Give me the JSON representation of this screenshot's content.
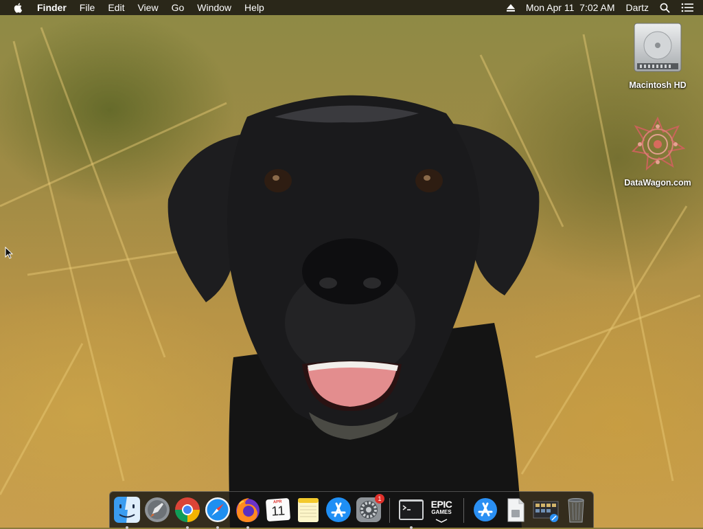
{
  "menubar": {
    "apple_icon": "apple-icon",
    "app_name": "Finder",
    "menus": [
      "File",
      "Edit",
      "View",
      "Go",
      "Window",
      "Help"
    ],
    "datetime": "Mon Apr 11  7:02 AM",
    "user": "Dartz",
    "status_icons": [
      "eject-icon",
      "spotlight-search-icon",
      "notification-center-icon"
    ]
  },
  "desktop": {
    "icons": [
      {
        "label": "Macintosh HD",
        "icon": "hard-drive-icon"
      },
      {
        "label": "DataWagon.com",
        "icon": "mandala-folder-icon"
      }
    ],
    "wallpaper": "black labrador dog in grass"
  },
  "dock": {
    "items": [
      {
        "name": "Finder",
        "icon": "finder-icon",
        "running": true
      },
      {
        "name": "Launchpad",
        "icon": "launchpad-icon",
        "running": false
      },
      {
        "name": "Google Chrome",
        "icon": "chrome-icon",
        "running": true
      },
      {
        "name": "Safari",
        "icon": "safari-icon",
        "running": true
      },
      {
        "name": "Firefox",
        "icon": "firefox-icon",
        "running": true
      },
      {
        "name": "Calendar",
        "icon": "calendar-icon",
        "running": false,
        "month": "APR",
        "day": "11"
      },
      {
        "name": "Notes",
        "icon": "notes-icon",
        "running": false
      },
      {
        "name": "App Store",
        "icon": "app-store-icon",
        "running": false
      },
      {
        "name": "System Preferences",
        "icon": "system-preferences-icon",
        "running": false,
        "badge": "1"
      },
      {
        "name": "Terminal",
        "icon": "terminal-icon",
        "running": true
      },
      {
        "name": "Epic Games Launcher",
        "icon": "epic-games-icon",
        "running": false,
        "line1": "EPIC",
        "line2": "GAMES"
      },
      {
        "name": "Downloads",
        "icon": "downloads-stack-icon",
        "running": false
      },
      {
        "name": "Documents",
        "icon": "document-stack-icon",
        "running": false
      },
      {
        "name": "Screenshots",
        "icon": "screenshots-stack-icon",
        "running": false
      },
      {
        "name": "Trash",
        "icon": "trash-icon",
        "running": false
      }
    ]
  },
  "colors": {
    "menubar_bg": "#221e16",
    "dock_bg": "#141414",
    "badge": "#e0302a",
    "wallpaper_grass": "#b89446"
  }
}
